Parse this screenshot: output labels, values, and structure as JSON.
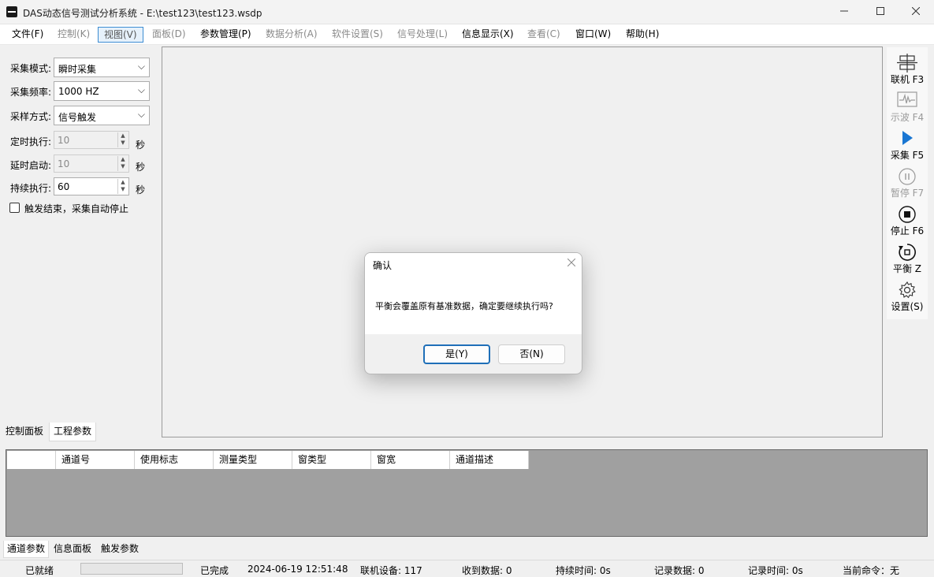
{
  "window": {
    "title": "DAS动态信号测试分析系统 - E:\\test123\\test123.wsdp",
    "minimize_icon": "minimize-icon",
    "maximize_icon": "maximize-icon",
    "close_icon": "close-icon"
  },
  "menu": [
    {
      "label": "文件(F)",
      "enabled": true,
      "active": false
    },
    {
      "label": "控制(K)",
      "enabled": false,
      "active": false
    },
    {
      "label": "视图(V)",
      "enabled": true,
      "active": true
    },
    {
      "label": "面板(D)",
      "enabled": false,
      "active": false
    },
    {
      "label": "参数管理(P)",
      "enabled": true,
      "active": false
    },
    {
      "label": "数据分析(A)",
      "enabled": false,
      "active": false
    },
    {
      "label": "软件设置(S)",
      "enabled": false,
      "active": false
    },
    {
      "label": "信号处理(L)",
      "enabled": false,
      "active": false
    },
    {
      "label": "信息显示(X)",
      "enabled": true,
      "active": false
    },
    {
      "label": "查看(C)",
      "enabled": false,
      "active": false
    },
    {
      "label": "窗口(W)",
      "enabled": true,
      "active": false
    },
    {
      "label": "帮助(H)",
      "enabled": true,
      "active": false
    }
  ],
  "control_panel": {
    "mode": {
      "label": "采集模式:",
      "value": "瞬时采集"
    },
    "rate": {
      "label": "采集频率:",
      "value": "1000 HZ"
    },
    "sampling": {
      "label": "采样方式:",
      "value": "信号触发"
    },
    "timed": {
      "label": "定时执行:",
      "value": "10",
      "unit": "秒",
      "enabled": false
    },
    "delay": {
      "label": "延时启动:",
      "value": "10",
      "unit": "秒",
      "enabled": false
    },
    "duration": {
      "label": "持续执行:",
      "value": "60",
      "unit": "秒",
      "enabled": true
    },
    "auto_stop": {
      "label": "触发结束，采集自动停止",
      "checked": false
    }
  },
  "left_tabs": [
    "控制面板",
    "工程参数"
  ],
  "toolbar": [
    {
      "label": "联机 F3",
      "icon": "network-icon",
      "enabled": true
    },
    {
      "label": "示波 F4",
      "icon": "oscilloscope-icon",
      "enabled": false
    },
    {
      "label": "采集 F5",
      "icon": "play-icon",
      "enabled": true
    },
    {
      "label": "暂停 F7",
      "icon": "pause-icon",
      "enabled": false
    },
    {
      "label": "停止 F6",
      "icon": "stop-icon",
      "enabled": true
    },
    {
      "label": "平衡 Z",
      "icon": "balance-icon",
      "enabled": true
    },
    {
      "label": "设置(S)",
      "icon": "gear-icon",
      "enabled": true
    }
  ],
  "grid": {
    "columns": [
      "",
      "通道号",
      "使用标志",
      "测量类型",
      "窗类型",
      "窗宽",
      "通道描述"
    ]
  },
  "bottom_tabs": [
    "通道参数",
    "信息面板",
    "触发参数"
  ],
  "status": {
    "ready": "已就绪",
    "progress": 0,
    "completed": "已完成",
    "datetime": "2024-06-19 12:51:48",
    "device": "联机设备: 117",
    "received": "收到数据: 0",
    "duration": "持续时间: 0s",
    "records": "记录数据: 0",
    "record_time": "记录时间: 0s",
    "command": "当前命令：无"
  },
  "dialog": {
    "title": "确认",
    "message": "平衡会覆盖原有基准数据，确定要继续执行吗?",
    "yes": "是(Y)",
    "no": "否(N)"
  }
}
